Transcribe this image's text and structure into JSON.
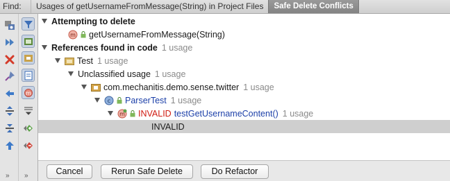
{
  "find_label": "Find:",
  "tabs": [
    {
      "label": "Usages of getUsernameFromMessage(String) in Project Files",
      "active": false
    },
    {
      "label": "Safe Delete Conflicts",
      "active": true
    }
  ],
  "toolbar_left": [
    "gear-icon",
    "rerun-icon",
    "close-icon",
    "pin-icon",
    "previous-icon",
    "expand-all-icon",
    "collapse-all-icon",
    "navigate-up-icon"
  ],
  "toolbar_right": [
    "filter-icon",
    "group-by-module-icon",
    "group-by-package-icon",
    "group-by-file-icon",
    "group-by-method-icon",
    "merge-lines-icon",
    "include-icon",
    "exclude-icon"
  ],
  "more_label": "»",
  "tree": {
    "attempting": {
      "label": "Attempting to delete"
    },
    "target": {
      "label": "getUsernameFromMessage(String)"
    },
    "references": {
      "label": "References found in code",
      "count": "1 usage"
    },
    "test": {
      "label": "Test",
      "count": "1 usage"
    },
    "unclassified": {
      "label": "Unclassified usage",
      "count": "1 usage"
    },
    "package": {
      "label": "com.mechanitis.demo.sense.twitter",
      "count": "1 usage"
    },
    "class": {
      "label": "ParserTest",
      "count": "1 usage"
    },
    "method": {
      "invalid": "INVALID",
      "label": "testGetUsernameContent()",
      "count": "1 usage"
    },
    "leaf": {
      "label": "INVALID"
    }
  },
  "buttons": {
    "cancel": "Cancel",
    "rerun": "Rerun Safe Delete",
    "refactor": "Do Refactor"
  },
  "colors": {
    "selected_row": "#cfcfcf",
    "invalid_red": "#d01a10",
    "link_blue": "#1b3fa8"
  }
}
